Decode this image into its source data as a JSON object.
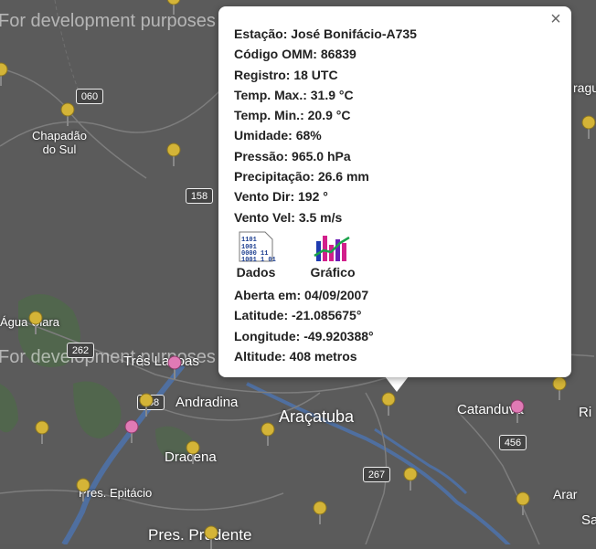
{
  "map": {
    "watermark_top": "For development purposes only",
    "watermark_mid": "For development purposes only",
    "places": [
      "Chapadão do Sul",
      "Água Clara",
      "Três Lagoas",
      "Andradina",
      "Araçatuba",
      "Catanduva",
      "Dracena",
      "Pres. Epitácio",
      "Pres. Prudente"
    ],
    "partial_places": [
      "Ri",
      "Arar",
      "Sa",
      "ragu"
    ],
    "shields": [
      "060",
      "158",
      "262",
      "158",
      "456",
      "267"
    ]
  },
  "popup": {
    "close_label": "×",
    "station_label": "Estação:",
    "station": "José Bonifácio-A735",
    "omm_label": "Código OMM:",
    "omm": "86839",
    "registro_label": "Registro:",
    "registro": "18 UTC",
    "tmax_label": "Temp. Max.:",
    "tmax": "31.9 °C",
    "tmin_label": "Temp. Min.:",
    "tmin": "20.9 °C",
    "umid_label": "Umidade:",
    "umid": "68%",
    "pressao_label": "Pressão:",
    "pressao": "965.0 hPa",
    "precip_label": "Precipitação:",
    "precip": "26.6 mm",
    "vdir_label": "Vento Dir:",
    "vdir": "192 °",
    "vvel_label": "Vento Vel:",
    "vvel": "3.5 m/s",
    "dados_label": "Dados",
    "grafico_label": "Gráfico",
    "data_icon_text": "1101 1001 0000 11 1001 1 01",
    "aberta_label": "Aberta em:",
    "aberta": "04/09/2007",
    "lat_label": "Latitude:",
    "lat": "-21.085675°",
    "lon_label": "Longitude:",
    "lon": "-49.920388°",
    "alt_label": "Altitude:",
    "alt": "408 metros"
  }
}
